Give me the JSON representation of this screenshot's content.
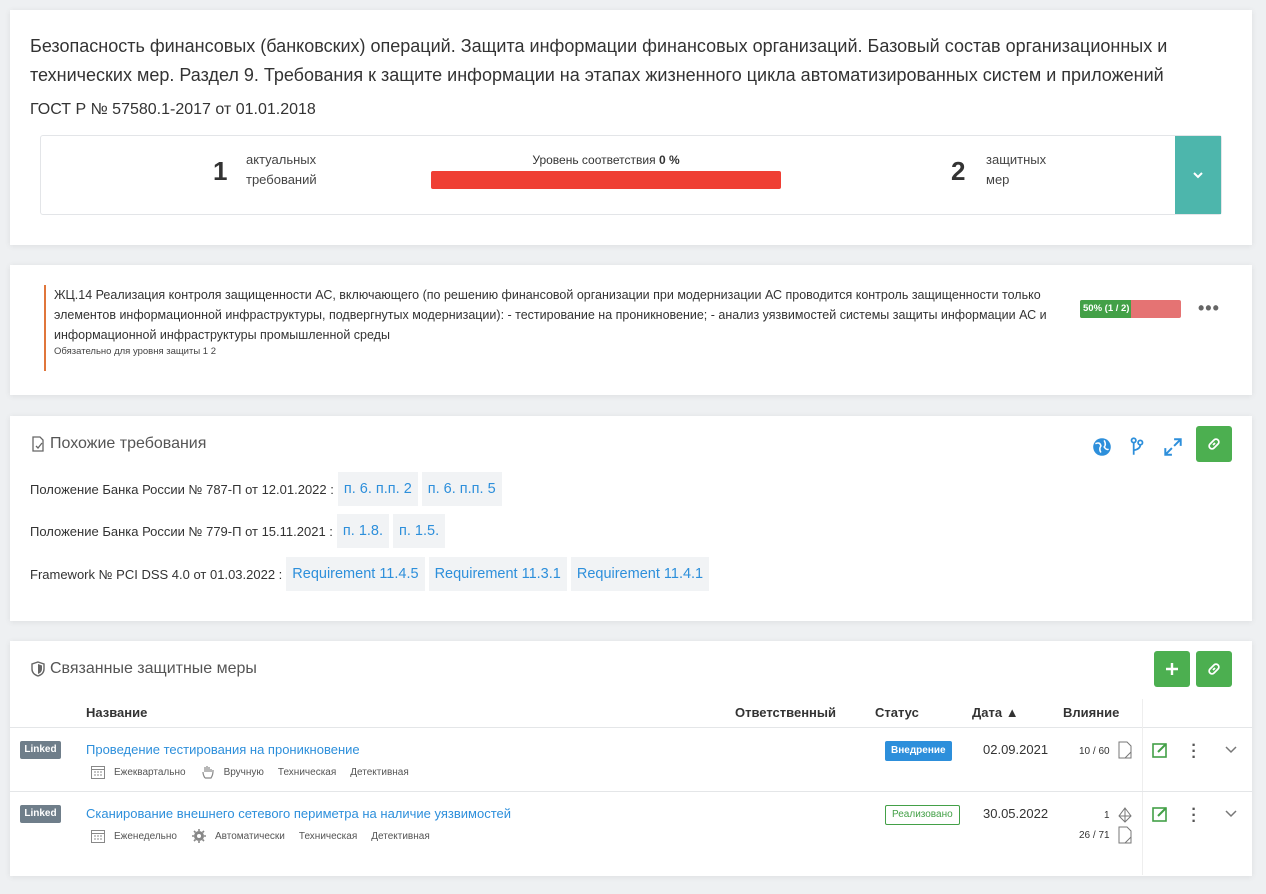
{
  "header": {
    "title": "Безопасность финансовых (банковских) операций. Защита информации финансовых организаций. Базовый состав организационных и технических мер. Раздел 9. Требования к защите информации на этапах жизненного цикла автоматизированных систем и приложений",
    "subtitle": "ГОСТ Р № 57580.1-2017 от 01.01.2018"
  },
  "summary": {
    "requirements_count": "1",
    "requirements_label_1": "актуальных",
    "requirements_label_2": "требований",
    "level_label": "Уровень соответствия",
    "level_value": "0 %",
    "level_fraction": 0.0,
    "measures_count": "2",
    "measures_label_1": "защитных",
    "measures_label_2": "мер"
  },
  "requirement": {
    "text": "ЖЦ.14 Реализация контроля защищенности АС, включающего (по решению финансовой организации при модернизации АС проводится контроль защищенности только элементов информационной инфраструктуры, подвергнутых модернизации): - тестирование на проникновение; - анализ уязвимостей системы защиты информации АС и информационной инфраструктуры промышленной среды",
    "note": "Обязательно для уровня защиты 1 2",
    "progress_text": "50% (1 / 2)",
    "progress_fraction": 0.5
  },
  "similar": {
    "title": "Похожие требования",
    "rows": [
      {
        "doc": "Положение Банка России № 787-П от 12.01.2022 :",
        "chips": [
          "п. 6. п.п. 2",
          "п. 6. п.п. 5"
        ]
      },
      {
        "doc": "Положение Банка России № 779-П от 15.11.2021 :",
        "chips": [
          "п. 1.8.",
          "п. 1.5."
        ]
      },
      {
        "doc": "Framework № PCI DSS 4.0 от 01.03.2022 :",
        "chips": [
          "Requirement 11.4.5",
          "Requirement 11.3.1",
          "Requirement 11.4.1"
        ]
      }
    ]
  },
  "measures": {
    "title": "Связанные защитные меры",
    "columns": {
      "name": "Название",
      "owner": "Ответственный",
      "status": "Статус",
      "date": "Дата ▲",
      "impact": "Влияние"
    },
    "rows": [
      {
        "badge": "Linked",
        "name": "Проведение тестирования на проникновение",
        "frequency": "Ежеквартально",
        "mode": "Вручную",
        "type": "Техническая",
        "kind": "Детективная",
        "status": "Внедрение",
        "date": "02.09.2021",
        "impact_docs": "10 / 60"
      },
      {
        "badge": "Linked",
        "name": "Сканирование внешнего сетевого периметра на наличие уязвимостей",
        "frequency": "Еженедельно",
        "mode": "Автоматически",
        "type": "Техническая",
        "kind": "Детективная",
        "status": "Реализовано",
        "date": "30.05.2022",
        "impact_assets": "1",
        "impact_docs": "26 / 71"
      }
    ]
  }
}
